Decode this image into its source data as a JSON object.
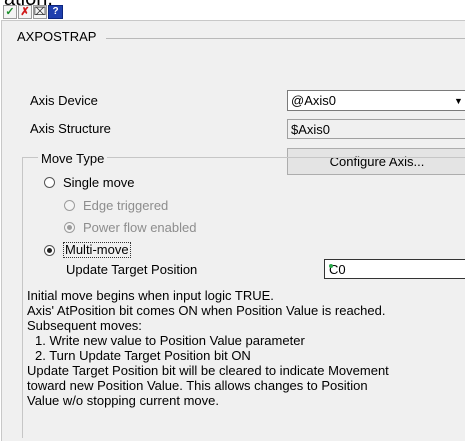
{
  "cut_title": "ation.",
  "toolbar": {
    "ok_glyph": "✓",
    "cancel_glyph": "✗",
    "pin_glyph": "⌧",
    "help_glyph": "?"
  },
  "group": {
    "title": "AXPOSTRAP"
  },
  "axis_device": {
    "label": "Axis Device",
    "value": "@Axis0",
    "arrow": "▼"
  },
  "axis_structure": {
    "label": "Axis Structure",
    "value": "$Axis0"
  },
  "configure_axis": {
    "label": "Configure Axis..."
  },
  "move_type": {
    "legend": "Move Type",
    "single_move": "Single move",
    "edge_triggered": "Edge triggered",
    "power_flow_enabled": "Power flow enabled",
    "multi_move": "Multi-move",
    "update_target_label": "Update Target Position",
    "update_target_value": "C0"
  },
  "description": [
    "Initial move begins when input logic TRUE.",
    "Axis' AtPosition bit comes ON when Position Value is reached.",
    "Subsequent moves:",
    "1. Write new value to Position Value parameter",
    "2. Turn Update Target Position bit ON",
    "Update Target Position bit will be cleared to indicate Movement",
    "toward new Position Value.  This allows changes to Position",
    "Value w/o stopping current move."
  ],
  "colors": {
    "ok": "#1a8f2a",
    "cancel": "#d01818",
    "help_bg": "#1f3fae"
  }
}
